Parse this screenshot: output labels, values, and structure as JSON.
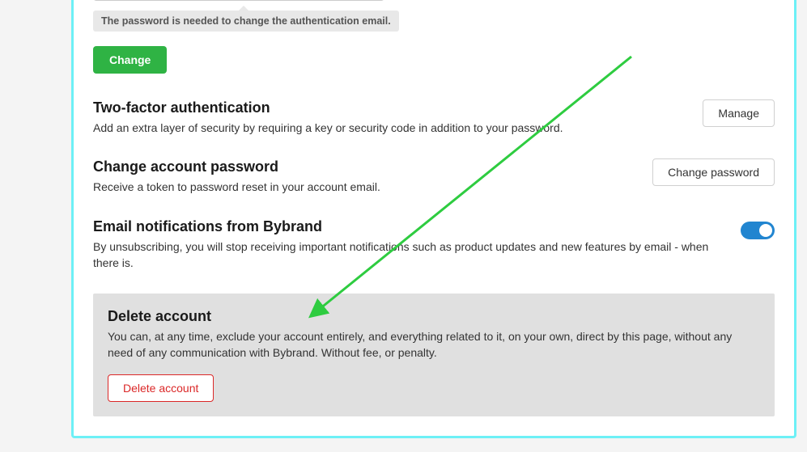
{
  "password_section": {
    "hint": "The password is needed to change the authentication email.",
    "change_button": "Change"
  },
  "two_factor": {
    "title": "Two-factor authentication",
    "desc": "Add an extra layer of security by requiring a key or security code in addition to your password.",
    "button": "Manage"
  },
  "change_password": {
    "title": "Change account password",
    "desc": "Receive a token to password reset in your account email.",
    "button": "Change password"
  },
  "email_notifications": {
    "title": "Email notifications from Bybrand",
    "desc": "By unsubscribing, you will stop receiving important notifications such as product updates and new features by email - when there is.",
    "toggle_on": true
  },
  "delete_account": {
    "title": "Delete account",
    "desc": "You can, at any time, exclude your account entirely, and everything related to it, on your own, direct by this page, without any need of any communication with Bybrand. Without fee, or penalty.",
    "button": "Delete account"
  },
  "annotation": {
    "arrow_color": "#2ecc40"
  }
}
